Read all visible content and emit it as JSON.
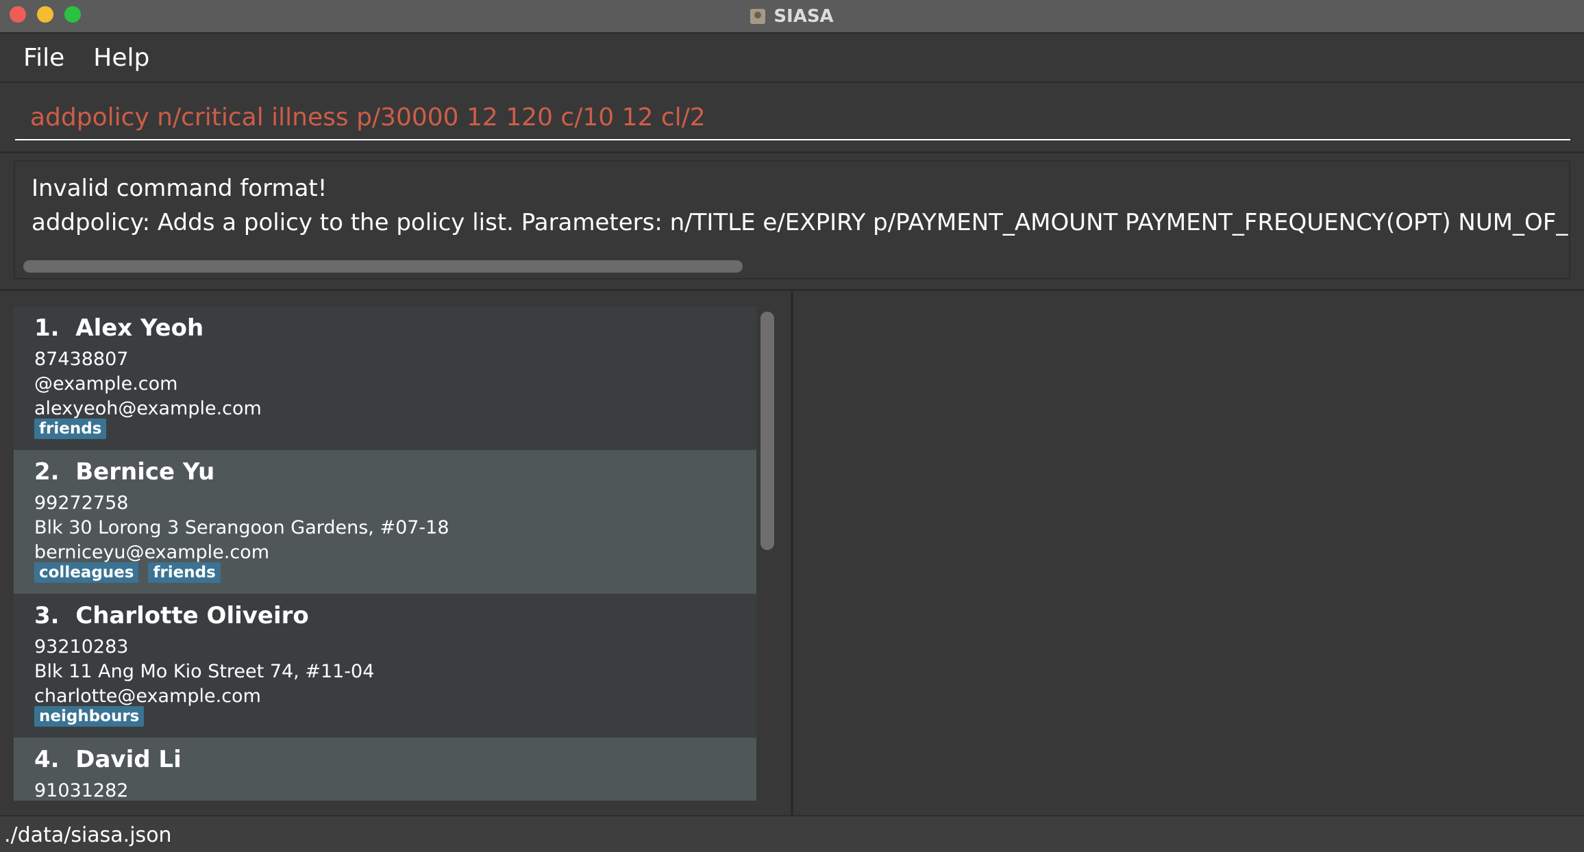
{
  "window": {
    "title": "SIASA"
  },
  "menu": {
    "file": "File",
    "help": "Help"
  },
  "command": {
    "value": "addpolicy n/critical illness p/30000 12 120 c/10 12 cl/2"
  },
  "result": {
    "line1": "Invalid command format!",
    "line2": "addpolicy: Adds a policy to the policy list. Parameters: n/TITLE e/EXPIRY p/PAYMENT_AMOUNT PAYMENT_FREQUENCY(OPT) NUM_OF_PAYMENTS(O"
  },
  "persons": [
    {
      "index": "1.",
      "name": "Alex Yeoh",
      "phone": "87438807",
      "address": "@example.com",
      "email": "alexyeoh@example.com",
      "tags": [
        "friends"
      ]
    },
    {
      "index": "2.",
      "name": "Bernice Yu",
      "phone": "99272758",
      "address": "Blk 30 Lorong 3 Serangoon Gardens, #07-18",
      "email": "berniceyu@example.com",
      "tags": [
        "colleagues",
        "friends"
      ]
    },
    {
      "index": "3.",
      "name": "Charlotte Oliveiro",
      "phone": "93210283",
      "address": "Blk 11 Ang Mo Kio Street 74, #11-04",
      "email": "charlotte@example.com",
      "tags": [
        "neighbours"
      ]
    },
    {
      "index": "4.",
      "name": "David Li",
      "phone": "91031282"
    }
  ],
  "status": {
    "path": "./data/siasa.json"
  },
  "colors": {
    "command_text": "#cf5d47",
    "tag_bg": "#3a7393",
    "card_odd": "#3b3e40",
    "card_even": "#505759"
  }
}
